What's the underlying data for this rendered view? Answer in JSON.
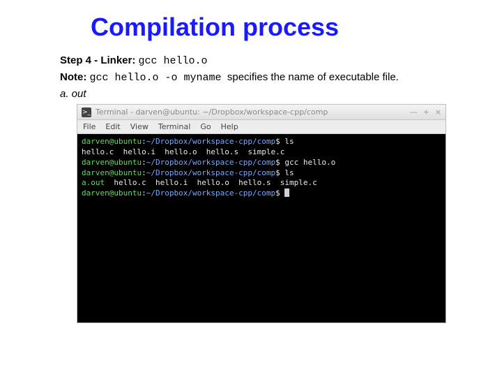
{
  "title": "Compilation process",
  "step_line": {
    "label": "Step 4 - Linker:",
    "cmd": "gcc hello.o"
  },
  "note_line": {
    "label": "Note:",
    "cmd": "gcc hello.o -o myname",
    "tail": "specifies the name of executable file."
  },
  "aout_text": "a. out",
  "window": {
    "title": "Terminal - darven@ubuntu: ~/Dropbox/workspace-cpp/comp",
    "btn_min": "—",
    "btn_max": "+",
    "btn_close": "×"
  },
  "menu": [
    "File",
    "Edit",
    "View",
    "Terminal",
    "Go",
    "Help"
  ],
  "prompt": {
    "user": "darven@ubuntu",
    "sep1": ":",
    "path": "~/Dropbox/workspace-cpp/comp",
    "sep2": "$"
  },
  "session": {
    "ls1_cmd": " ls",
    "ls1_out": "hello.c  hello.i  hello.o  hello.s  simple.c",
    "gcc_cmd": " gcc hello.o",
    "ls2_cmd": " ls",
    "ls2_aout": "a.out",
    "ls2_rest": "  hello.c  hello.i  hello.o  hello.s  simple.c",
    "final_cmd": " "
  }
}
